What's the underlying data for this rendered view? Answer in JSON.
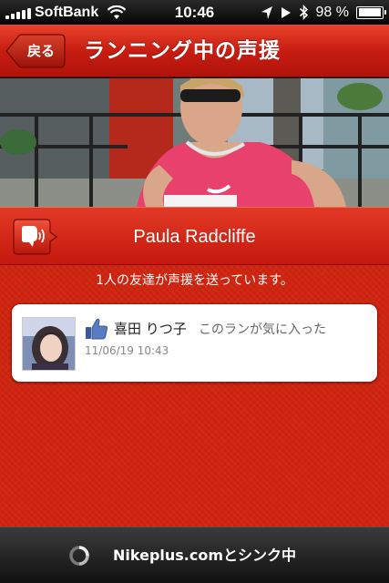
{
  "status_bar": {
    "carrier": "SoftBank",
    "time": "10:46",
    "battery_text": "98 %",
    "battery_level": 0.98,
    "icons": [
      "signal-icon",
      "wifi-icon",
      "location-icon",
      "play-icon",
      "bluetooth-icon",
      "battery-icon"
    ]
  },
  "nav": {
    "back_label": "戻る",
    "title": "ランニング中の声援"
  },
  "runner": {
    "name": "Paula Radcliffe",
    "icon": "cheer-speaker-icon"
  },
  "cheers": {
    "summary": "1人の友達が声援を送っています。",
    "items": [
      {
        "friend_name": "喜田 りつ子",
        "message": "このランが気に入った",
        "timestamp": "11/06/19  10:43",
        "icon": "thumbs-up-icon"
      }
    ]
  },
  "footer": {
    "sync_text": "Nikeplus.comとシンク中",
    "icon": "spinner-icon"
  },
  "colors": {
    "accent_red": "#c81d12",
    "content_red": "#cf2410",
    "like_blue": "#3b5998"
  }
}
